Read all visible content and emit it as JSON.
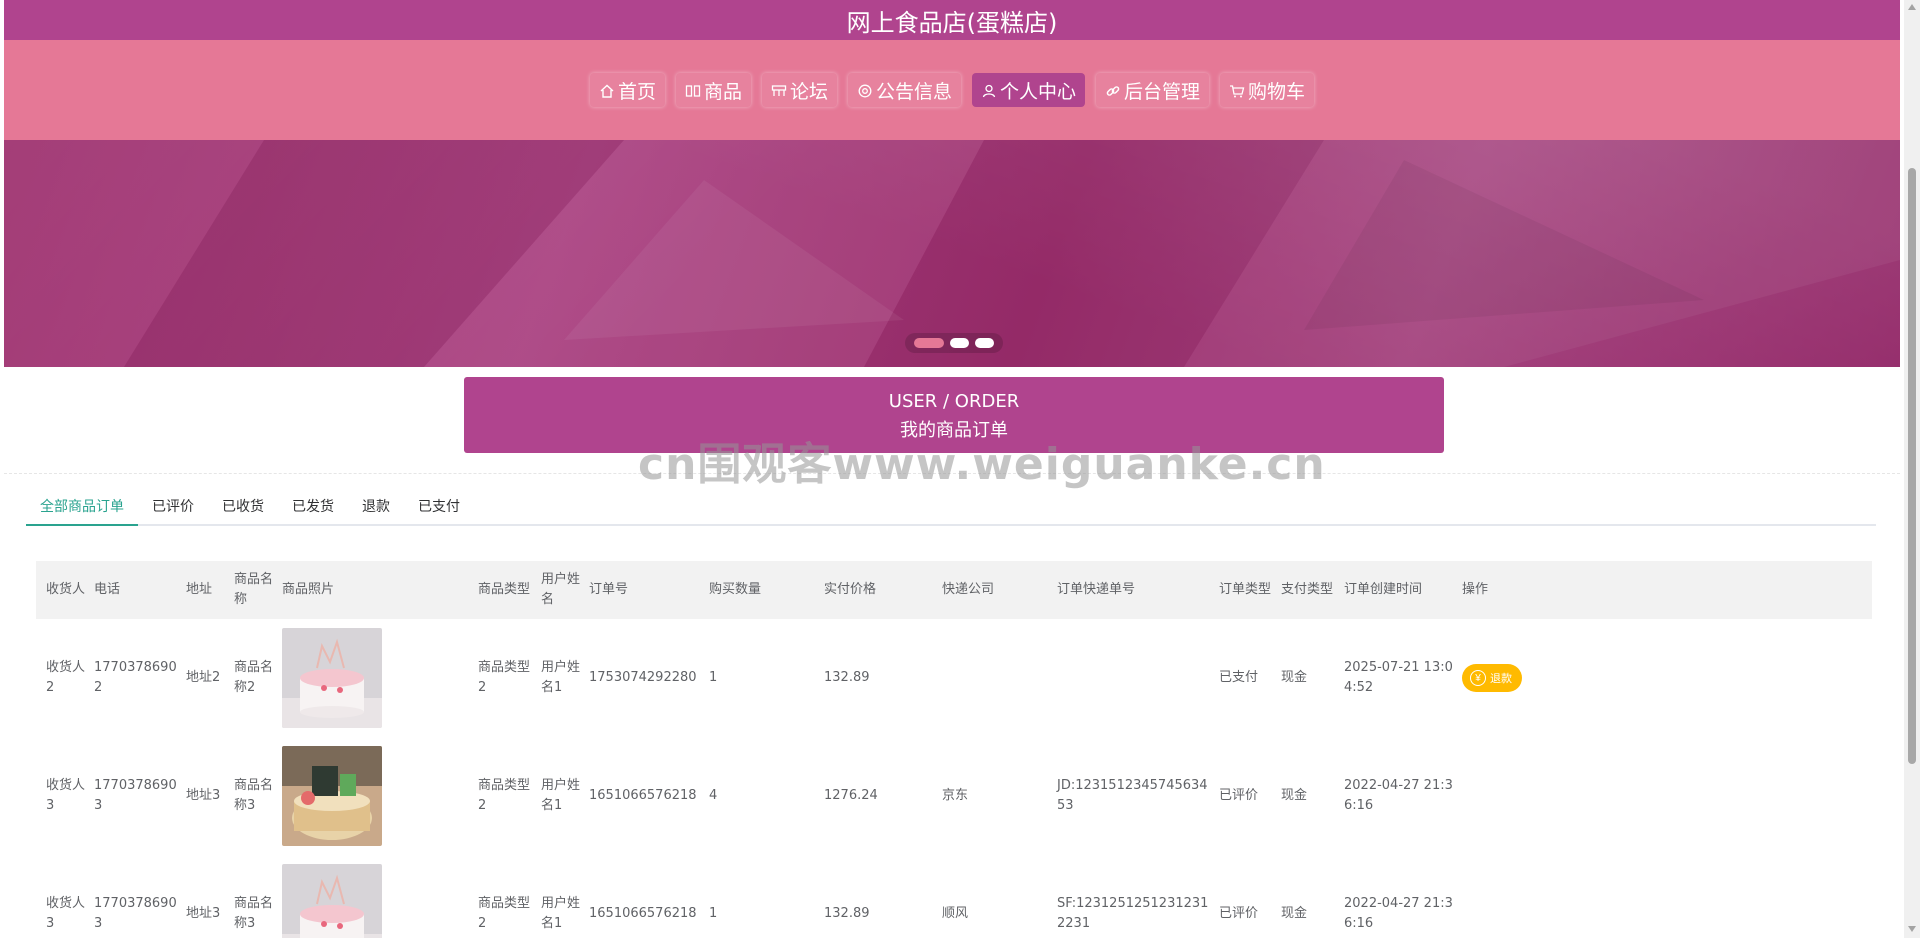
{
  "header": {
    "title": "网上食品店(蛋糕店)"
  },
  "nav": {
    "items": [
      {
        "icon": "home-icon",
        "label": "首页",
        "active": false
      },
      {
        "icon": "grid-icon",
        "label": "商品",
        "active": false
      },
      {
        "icon": "forum-icon",
        "label": "论坛",
        "active": false
      },
      {
        "icon": "at-icon",
        "label": "公告信息",
        "active": false
      },
      {
        "icon": "user-icon",
        "label": "个人中心",
        "active": true
      },
      {
        "icon": "link-icon",
        "label": "后台管理",
        "active": false
      },
      {
        "icon": "cart-icon",
        "label": "购物车",
        "active": false
      }
    ]
  },
  "carousel": {
    "slide_count": 3,
    "active_index": 0
  },
  "section": {
    "en": "USER / ORDER",
    "zh": "我的商品订单"
  },
  "watermark": "cn围观客www.weiguanke.cn",
  "tabs": [
    {
      "label": "全部商品订单",
      "active": true
    },
    {
      "label": "已评价",
      "active": false
    },
    {
      "label": "已收货",
      "active": false
    },
    {
      "label": "已发货",
      "active": false
    },
    {
      "label": "退款",
      "active": false
    },
    {
      "label": "已支付",
      "active": false
    }
  ],
  "table": {
    "headers": [
      "收货人",
      "电话",
      "地址",
      "商品名称",
      "商品照片",
      "商品类型",
      "用户姓名",
      "订单号",
      "购买数量",
      "实付价格",
      "快递公司",
      "订单快递单号",
      "订单类型",
      "支付类型",
      "订单创建时间",
      "操作"
    ],
    "rows": [
      {
        "receiver": "收货人2",
        "phone": "17703786902",
        "address": "地址2",
        "product": "商品名称2",
        "photo": "cake-pink",
        "type": "商品类型2",
        "user": "用户姓名1",
        "order_no": "1753074292280",
        "qty": "1",
        "price": "132.89",
        "courier": "",
        "tracking": "",
        "status": "已支付",
        "pay": "现金",
        "created": "2025-07-21 13:04:52",
        "action": "退款"
      },
      {
        "receiver": "收货人3",
        "phone": "17703786903",
        "address": "地址3",
        "product": "商品名称3",
        "photo": "cake-gold",
        "type": "商品类型2",
        "user": "用户姓名1",
        "order_no": "1651066576218",
        "qty": "4",
        "price": "1276.24",
        "courier": "京东",
        "tracking": "JD:123151234574563453",
        "status": "已评价",
        "pay": "现金",
        "created": "2022-04-27 21:36:16",
        "action": ""
      },
      {
        "receiver": "收货人3",
        "phone": "17703786903",
        "address": "地址3",
        "product": "商品名称3",
        "photo": "cake-pink",
        "type": "商品类型2",
        "user": "用户姓名1",
        "order_no": "1651066576218",
        "qty": "1",
        "price": "132.89",
        "courier": "顺风",
        "tracking": "SF:12312512512312312231",
        "status": "已评价",
        "pay": "现金",
        "created": "2022-04-27 21:36:16",
        "action": ""
      }
    ]
  },
  "colors": {
    "title_bar": "#b0448e",
    "nav_bar": "#e57896",
    "accent_tab": "#2aa38f",
    "refund_button": "#ffba00"
  }
}
